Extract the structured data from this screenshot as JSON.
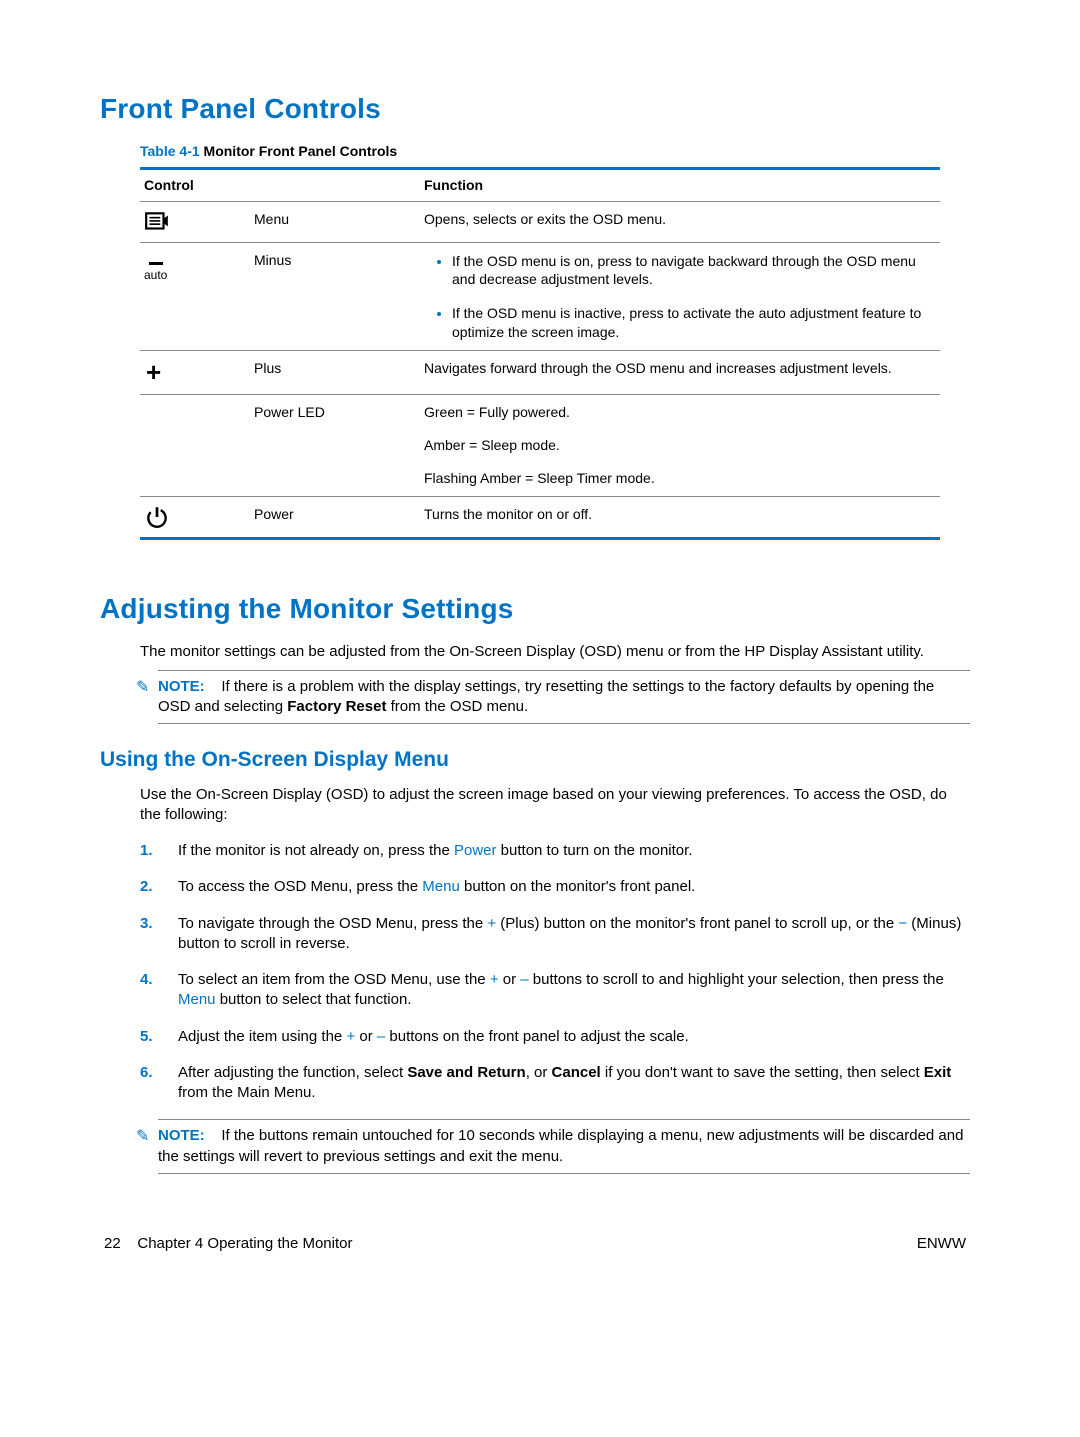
{
  "section1_title": "Front Panel Controls",
  "table": {
    "caption_prefix": "Table 4-1",
    "caption_rest": "  Monitor Front Panel Controls",
    "head_control": "Control",
    "head_function": "Function",
    "rows": [
      {
        "icon": "menu",
        "name": "Menu",
        "func_paras": [
          "Opens, selects or exits the OSD menu."
        ],
        "func_bullets": []
      },
      {
        "icon": "auto",
        "name": "Minus",
        "func_paras": [],
        "func_bullets": [
          "If the OSD menu is on, press to navigate backward through the OSD menu and decrease adjustment levels.",
          "If the OSD menu is inactive, press to activate the auto adjustment feature to optimize the screen image."
        ]
      },
      {
        "icon": "plus",
        "name": "Plus",
        "func_paras": [
          "Navigates forward through the OSD menu and increases adjustment levels."
        ],
        "func_bullets": []
      },
      {
        "icon": "",
        "name": "Power LED",
        "func_paras": [
          "Green = Fully powered.",
          "Amber = Sleep mode.",
          "Flashing Amber = Sleep Timer mode."
        ],
        "func_bullets": []
      },
      {
        "icon": "power",
        "name": "Power",
        "func_paras": [
          "Turns the monitor on or off."
        ],
        "func_bullets": []
      }
    ],
    "auto_text": "auto"
  },
  "section2_title": "Adjusting the Monitor Settings",
  "section2_intro": "The monitor settings can be adjusted from the On-Screen Display (OSD) menu or from the HP Display Assistant utility.",
  "note1": {
    "label": "NOTE:",
    "text_before": "If there is a problem with the display settings, try resetting the settings to the factory defaults by opening the OSD and selecting ",
    "bold": "Factory Reset",
    "text_after": " from the OSD menu."
  },
  "subsection_title": "Using the On-Screen Display Menu",
  "subsection_intro": "Use the On-Screen Display (OSD) to adjust the screen image based on your viewing preferences. To access the OSD, do the following:",
  "steps": {
    "s1_a": "If the monitor is not already on, press the ",
    "s1_hl1": "Power",
    "s1_b": " button to turn on the monitor.",
    "s2_a": "To access the OSD Menu, press the ",
    "s2_hl1": "Menu",
    "s2_b": " button on the monitor's front panel.",
    "s3_a": "To navigate through the OSD Menu, press the ",
    "s3_hl1": "+",
    "s3_b": " (Plus) button on the monitor's front panel to scroll up, or the ",
    "s3_hl2": "−",
    "s3_c": " (Minus) button to scroll in reverse.",
    "s4_a": "To select an item from the OSD Menu, use the ",
    "s4_hl1": "+",
    "s4_b": " or ",
    "s4_hl2": "–",
    "s4_c": " buttons to scroll to and highlight your selection, then press the ",
    "s4_hl3": "Menu",
    "s4_d": " button to select that function.",
    "s5_a": "Adjust the item using the ",
    "s5_hl1": "+",
    "s5_b": " or ",
    "s5_hl2": "–",
    "s5_c": " buttons on the front panel to adjust the scale.",
    "s6_a": "After adjusting the function, select ",
    "s6_b1": "Save and Return",
    "s6_b": ", or ",
    "s6_b2": "Cancel",
    "s6_c": " if you don't want to save the setting, then select ",
    "s6_b3": "Exit",
    "s6_d": " from the Main Menu."
  },
  "note2": {
    "label": "NOTE:",
    "text": "If the buttons remain untouched for 10 seconds while displaying a menu, new adjustments will be discarded and the settings will revert to previous settings and exit the menu."
  },
  "footer": {
    "page_number": "22",
    "chapter": "Chapter 4   Operating the Monitor",
    "right": "ENWW"
  }
}
